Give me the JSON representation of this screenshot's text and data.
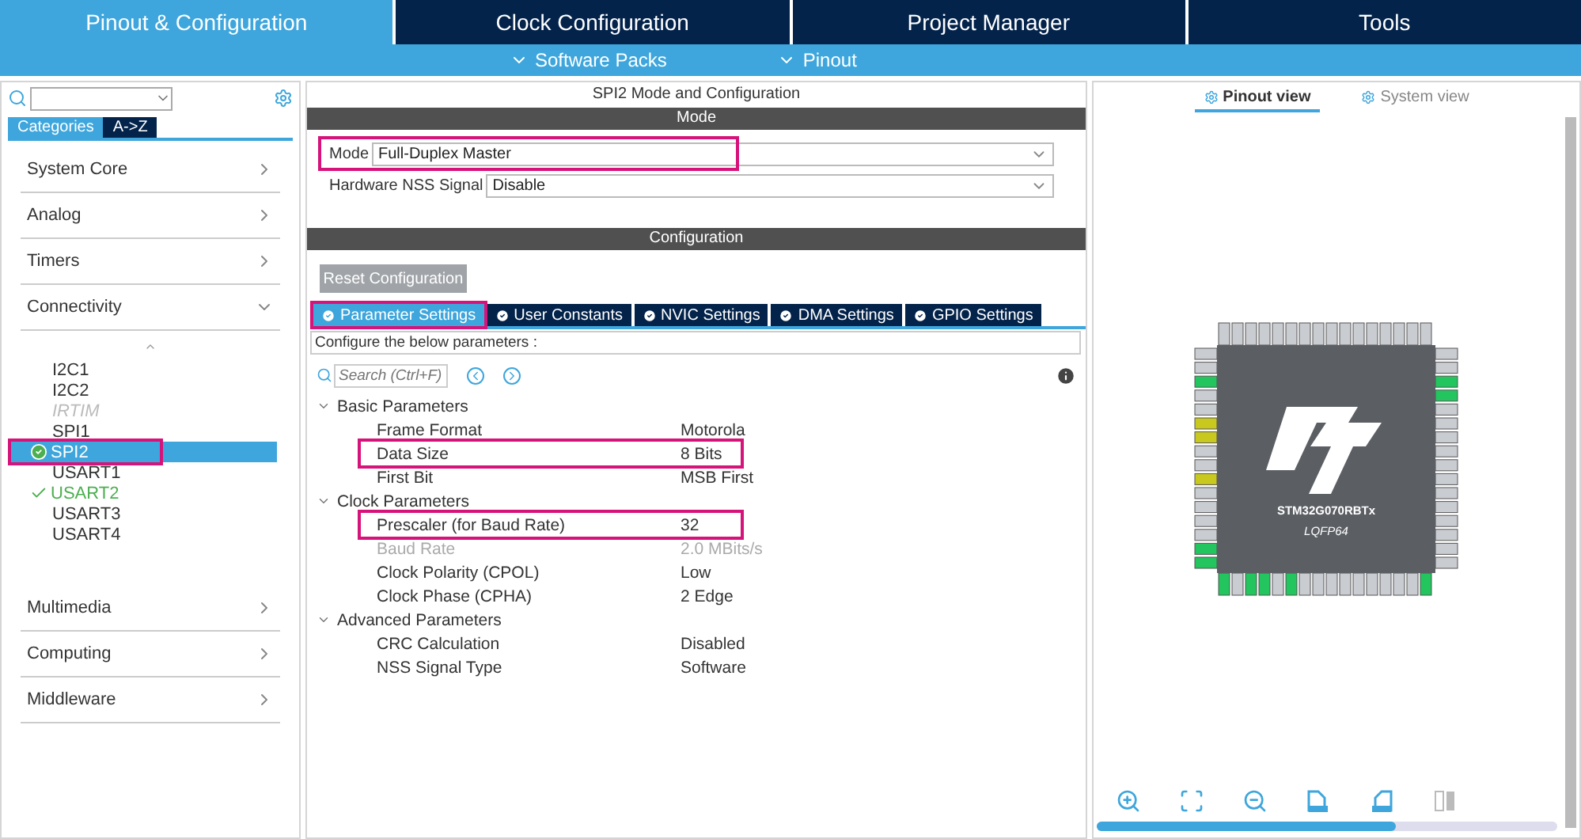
{
  "top_tabs": [
    {
      "label": "Pinout & Configuration",
      "selected": true
    },
    {
      "label": "Clock Configuration",
      "selected": false
    },
    {
      "label": "Project Manager",
      "selected": false
    },
    {
      "label": "Tools",
      "selected": false
    }
  ],
  "sub_menus": [
    "Software Packs",
    "Pinout"
  ],
  "sidebar": {
    "view_tabs": [
      {
        "label": "Categories",
        "selected": true
      },
      {
        "label": "A->Z",
        "selected": false
      }
    ],
    "categories": [
      {
        "label": "System Core",
        "expanded": false
      },
      {
        "label": "Analog",
        "expanded": false
      },
      {
        "label": "Timers",
        "expanded": false
      },
      {
        "label": "Connectivity",
        "expanded": true,
        "children": [
          {
            "label": "I2C1",
            "configured": false,
            "disabled": false,
            "selected": false,
            "highlighted": false
          },
          {
            "label": "I2C2",
            "configured": false,
            "disabled": false,
            "selected": false,
            "highlighted": false
          },
          {
            "label": "IRTIM",
            "configured": false,
            "disabled": true,
            "selected": false,
            "highlighted": false
          },
          {
            "label": "SPI1",
            "configured": false,
            "disabled": false,
            "selected": false,
            "highlighted": false
          },
          {
            "label": "SPI2",
            "configured": true,
            "disabled": false,
            "selected": true,
            "highlighted": true
          },
          {
            "label": "USART1",
            "configured": false,
            "disabled": false,
            "selected": false,
            "highlighted": false
          },
          {
            "label": "USART2",
            "configured": true,
            "disabled": false,
            "selected": false,
            "highlighted": false
          },
          {
            "label": "USART3",
            "configured": false,
            "disabled": false,
            "selected": false,
            "highlighted": false
          },
          {
            "label": "USART4",
            "configured": false,
            "disabled": false,
            "selected": false,
            "highlighted": false
          }
        ]
      },
      {
        "label": "Multimedia",
        "expanded": false
      },
      {
        "label": "Computing",
        "expanded": false
      },
      {
        "label": "Middleware",
        "expanded": false
      }
    ]
  },
  "config": {
    "title": "SPI2 Mode and Configuration",
    "mode_header": "Mode",
    "mode_fields": [
      {
        "label": "Mode",
        "value": "Full-Duplex Master",
        "highlighted": true
      },
      {
        "label": "Hardware NSS Signal",
        "value": "Disable",
        "highlighted": false
      }
    ],
    "config_header": "Configuration",
    "reset_button": "Reset Configuration",
    "tabs": [
      {
        "label": "Parameter Settings",
        "selected": true,
        "highlighted": true
      },
      {
        "label": "User Constants",
        "selected": false,
        "highlighted": false
      },
      {
        "label": "NVIC Settings",
        "selected": false,
        "highlighted": false
      },
      {
        "label": "DMA Settings",
        "selected": false,
        "highlighted": false
      },
      {
        "label": "GPIO Settings",
        "selected": false,
        "highlighted": false
      }
    ],
    "hint": "Configure the below parameters :",
    "search": {
      "placeholder": "Search (Ctrl+F)"
    },
    "groups": [
      {
        "label": "Basic Parameters",
        "expanded": true,
        "params": [
          {
            "name": "Frame Format",
            "value": "Motorola",
            "disabled": false,
            "highlighted": false
          },
          {
            "name": "Data Size",
            "value": "8 Bits",
            "disabled": false,
            "highlighted": true
          },
          {
            "name": "First Bit",
            "value": "MSB First",
            "disabled": false,
            "highlighted": false
          }
        ]
      },
      {
        "label": "Clock Parameters",
        "expanded": true,
        "params": [
          {
            "name": "Prescaler (for Baud Rate)",
            "value": "32",
            "disabled": false,
            "highlighted": true
          },
          {
            "name": "Baud Rate",
            "value": "2.0 MBits/s",
            "disabled": true,
            "highlighted": false
          },
          {
            "name": "Clock Polarity (CPOL)",
            "value": "Low",
            "disabled": false,
            "highlighted": false
          },
          {
            "name": "Clock Phase (CPHA)",
            "value": "2 Edge",
            "disabled": false,
            "highlighted": false
          }
        ]
      },
      {
        "label": "Advanced Parameters",
        "expanded": true,
        "params": [
          {
            "name": "CRC Calculation",
            "value": "Disabled",
            "disabled": false,
            "highlighted": false
          },
          {
            "name": "NSS Signal Type",
            "value": "Software",
            "disabled": false,
            "highlighted": false
          }
        ]
      }
    ]
  },
  "pinout": {
    "view_tabs": [
      {
        "label": "Pinout view",
        "selected": true
      },
      {
        "label": "System view",
        "selected": false
      }
    ],
    "chip": {
      "part": "STM32G070RBTx",
      "package": "LQFP64"
    }
  }
}
